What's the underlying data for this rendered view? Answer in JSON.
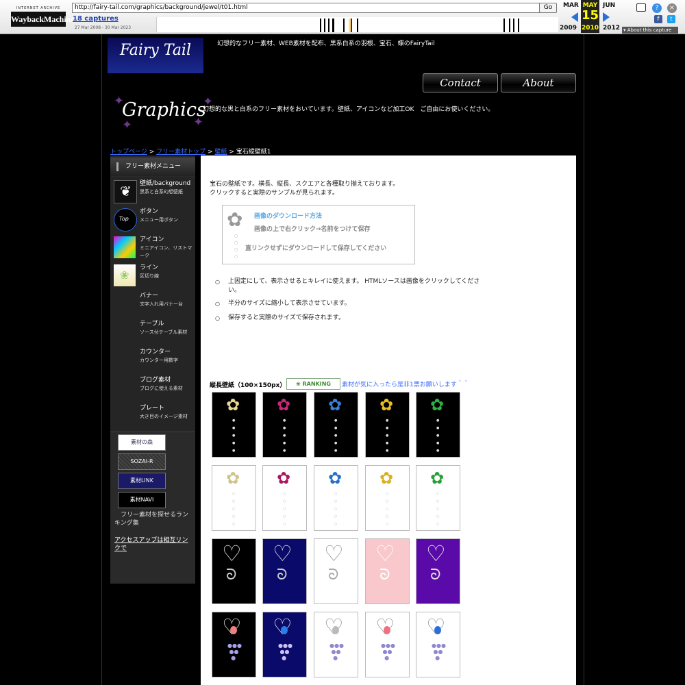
{
  "wayback": {
    "ia_label": "INTERNET ARCHIVE",
    "logo_label": "WaybackMachine",
    "url": "http://fairy-tail.com/graphics/background/jewel/t01.html",
    "go_label": "Go",
    "captures": "18 captures",
    "range": "27 Mar 2008 - 30 Mar 2023",
    "prev_month": "MAR",
    "cur_month": "MAY",
    "next_month": "JUN",
    "day": "15",
    "prev_year": "2009",
    "cur_year": "2010",
    "next_year": "2012",
    "about_capture": "About this capture"
  },
  "site": {
    "logo": "Fairy Tail",
    "tagline": "幻想的なフリー素材、WEB素材を配布、黒系白系の羽根、宝石、蝶のFairyTail",
    "nav": [
      "Contact",
      "About"
    ],
    "section_title": "Graphics",
    "section_desc": "幻想的な黒と白系のフリー素材をおいています。壁紙、アイコンなど加工OK　ご自由にお使いください。"
  },
  "breadcrumb": {
    "items": [
      "トップページ",
      "フリー素材トップ",
      "壁紙"
    ],
    "sep": ">",
    "current": "宝石縦壁紙1"
  },
  "sidebar": {
    "title": "フリー素材メニュー",
    "items": [
      {
        "title": "壁紙/background",
        "sub": "黒系と白系幻想壁紙"
      },
      {
        "title": "ボタン",
        "sub": "メニュー用ボタン"
      },
      {
        "title": "アイコン",
        "sub": "ミニアイコン、リストマーク"
      },
      {
        "title": "ライン",
        "sub": "区切り線"
      },
      {
        "title": "バナー",
        "sub": "文字入れ用バナー台"
      },
      {
        "title": "テーブル",
        "sub": "ソース付テーブル素材"
      },
      {
        "title": "カウンター",
        "sub": "カウンター用数字"
      },
      {
        "title": "ブログ素材",
        "sub": "ブログに使える素材"
      },
      {
        "title": "プレート",
        "sub": "大き目のイメージ素材"
      }
    ],
    "ranking_banners": [
      "素材の森",
      "SOZAI-R",
      "素材LINK",
      "素材NAVI"
    ],
    "ranking_note": "　フリー素材を探せるランキング集",
    "mutual_link": "アクセスアップは相互リンクで"
  },
  "content": {
    "intro_1": "宝石の壁紙です。横長、縦長、スクエアと各種取り揃えております。",
    "intro_2": "クリックすると実際のサンプルが見られます。",
    "download": {
      "title": "画像のダウンロード方法",
      "step": "画像の上で右クリック→名前をつけて保存",
      "warning": "直リンクせずにダウンロードして保存してください"
    },
    "notes": [
      "上固定にして、表示させるとキレイに使えます。 HTMLソースは画像をクリックしてください。",
      "半分のサイズに縮小して表示させています。",
      "保存すると実際のサイズで保存されます。"
    ],
    "gallery_heading": "縦長壁紙（100×150px）",
    "ranking_badge": "RANKING",
    "vote_text": "素材が気に入ったら是非1票お願いします＾＾"
  },
  "colors": {
    "link": "#3b6cff",
    "calendar_highlight": "#ffff00"
  }
}
